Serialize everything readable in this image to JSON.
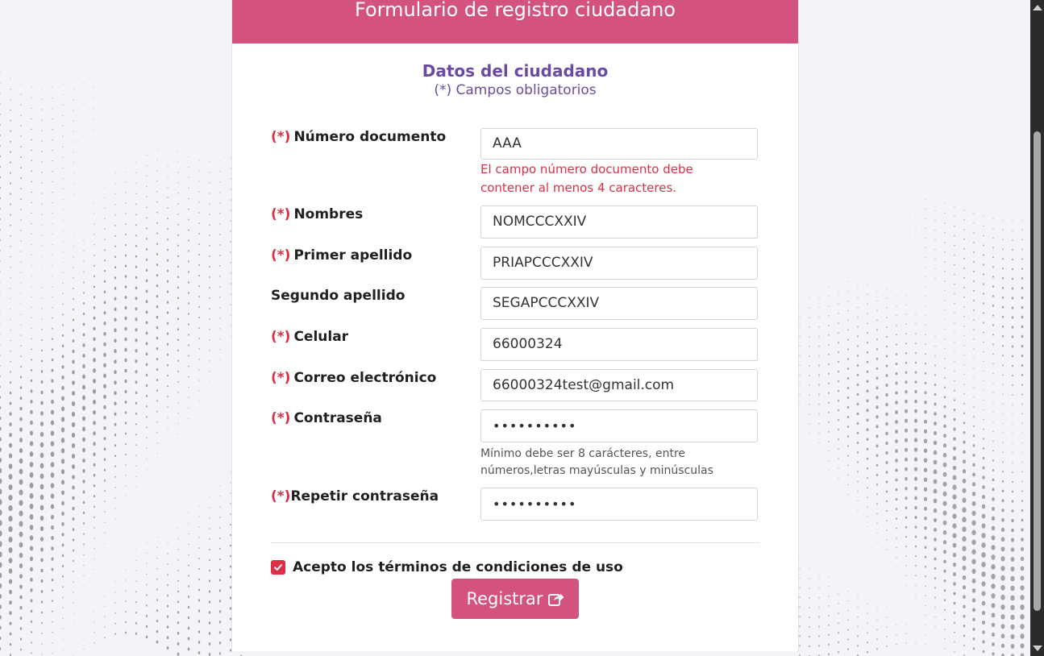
{
  "header": {
    "title": "Formulario de registro ciudadano"
  },
  "section": {
    "title": "Datos del ciudadano",
    "subtitle": "(*) Campos obligatorios"
  },
  "required_marker": "(*)",
  "fields": {
    "documento": {
      "label": "Número documento",
      "value": "AAA",
      "error": "El campo número documento debe contener al menos 4 caracteres."
    },
    "nombres": {
      "label": "Nombres",
      "value": "NOMCCCXXIV"
    },
    "primer_apellido": {
      "label": "Primer apellido",
      "value": "PRIAPCCCXXIV"
    },
    "segundo_apellido": {
      "label": "Segundo apellido",
      "value": "SEGAPCCCXXIV"
    },
    "celular": {
      "label": "Celular",
      "value": "66000324"
    },
    "correo": {
      "label": "Correo electrónico",
      "value": "66000324test@gmail.com"
    },
    "contrasena": {
      "label": "Contraseña",
      "value": "••••••••••",
      "hint": "Mínimo debe ser 8 carácteres, entre números,letras mayúsculas y minúsculas"
    },
    "repetir_contrasena": {
      "label": "Repetir contraseña",
      "value": "••••••••••"
    }
  },
  "terms": {
    "label": "Acepto los términos de condiciones de uso",
    "checked": true
  },
  "submit": {
    "label": "Registrar",
    "icon": "share-icon"
  },
  "colors": {
    "header": "#d4527f",
    "title": "#6a4ba0",
    "required": "#dc2f45",
    "button": "#d4527f"
  }
}
